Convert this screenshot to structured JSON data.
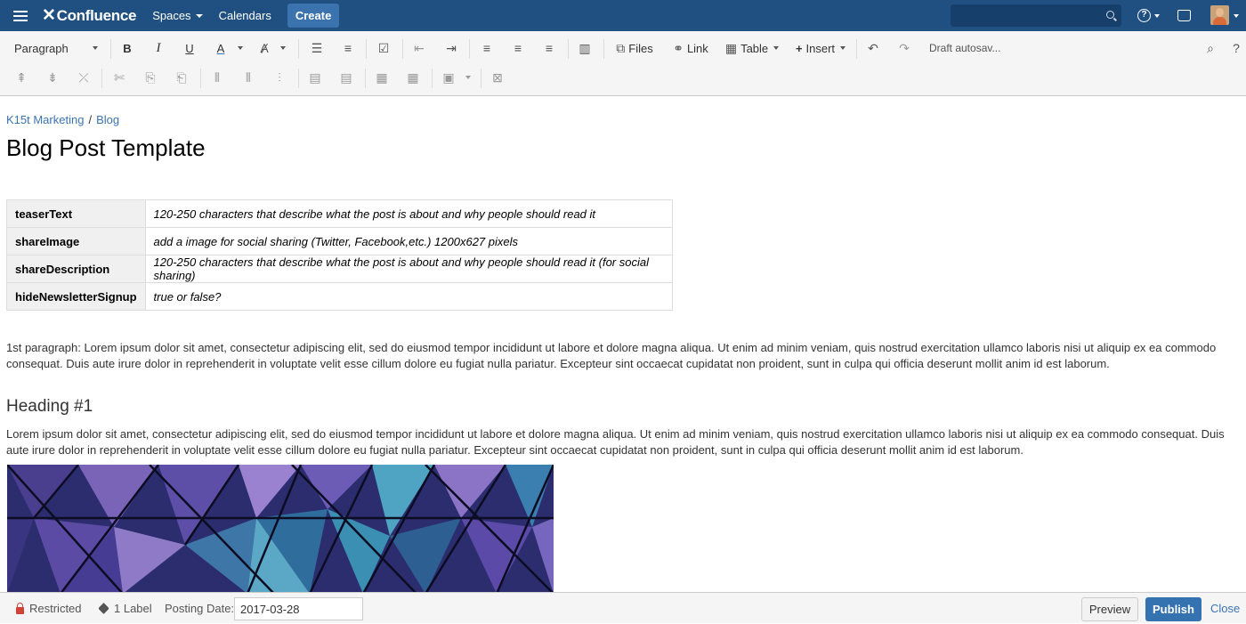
{
  "topnav": {
    "logo": "Confluence",
    "logo_mark": "✕",
    "spaces": "Spaces",
    "calendars": "Calendars",
    "create": "Create",
    "help_glyph": "?"
  },
  "toolbar": {
    "paragraph": "Paragraph",
    "bold": "B",
    "italic": "I",
    "underline": "U",
    "text_color": "A",
    "files": "Files",
    "link": "Link",
    "table": "Table",
    "insert": "Insert",
    "draft": "Draft autosav...",
    "help": "?"
  },
  "page": {
    "breadcrumb": [
      "K15t Marketing",
      "Blog"
    ],
    "title": "Blog Post Template",
    "meta_table": [
      {
        "key": "teaserText",
        "value": "120-250 characters that describe what the post is about and why people should read it"
      },
      {
        "key": "shareImage",
        "value": "add a image for social sharing (Twitter, Facebook,etc.) 1200x627 pixels"
      },
      {
        "key": "shareDescription",
        "value": "120-250 characters that describe what the post is about and why people should read it (for social sharing)"
      },
      {
        "key": "hideNewsletterSignup",
        "value": "true or false?"
      }
    ],
    "paragraph1": "1st paragraph: Lorem ipsum dolor sit amet, consectetur adipiscing elit, sed do eiusmod tempor incididunt ut labore et dolore magna aliqua. Ut enim ad minim veniam, quis nostrud exercitation ullamco laboris nisi ut aliquip ex ea commodo consequat. Duis aute irure dolor in reprehenderit in voluptate velit esse cillum dolore eu fugiat nulla pariatur. Excepteur sint occaecat cupidatat non proident, sunt in culpa qui officia deserunt mollit anim id est laborum.",
    "heading1": "Heading #1",
    "paragraph2": "Lorem ipsum dolor sit amet, consectetur adipiscing elit, sed do eiusmod tempor incididunt ut labore et dolore magna aliqua. Ut enim ad minim veniam, quis nostrud exercitation ullamco laboris nisi ut aliquip ex ea commodo consequat. Duis aute irure dolor in reprehenderit in voluptate velit esse cillum dolore eu fugiat nulla pariatur. Excepteur sint occaecat cupidatat non proident, sunt in culpa qui officia deserunt mollit anim id est laborum."
  },
  "footer": {
    "restricted": "Restricted",
    "labels": "1 Label",
    "posting_date_label": "Posting Date:",
    "posting_date_value": "2017-03-28",
    "preview": "Preview",
    "publish": "Publish",
    "close": "Close"
  },
  "colors": {
    "nav": "#205081",
    "publish": "#3572b0",
    "link": "#3b73af",
    "restricted": "#d04437"
  }
}
